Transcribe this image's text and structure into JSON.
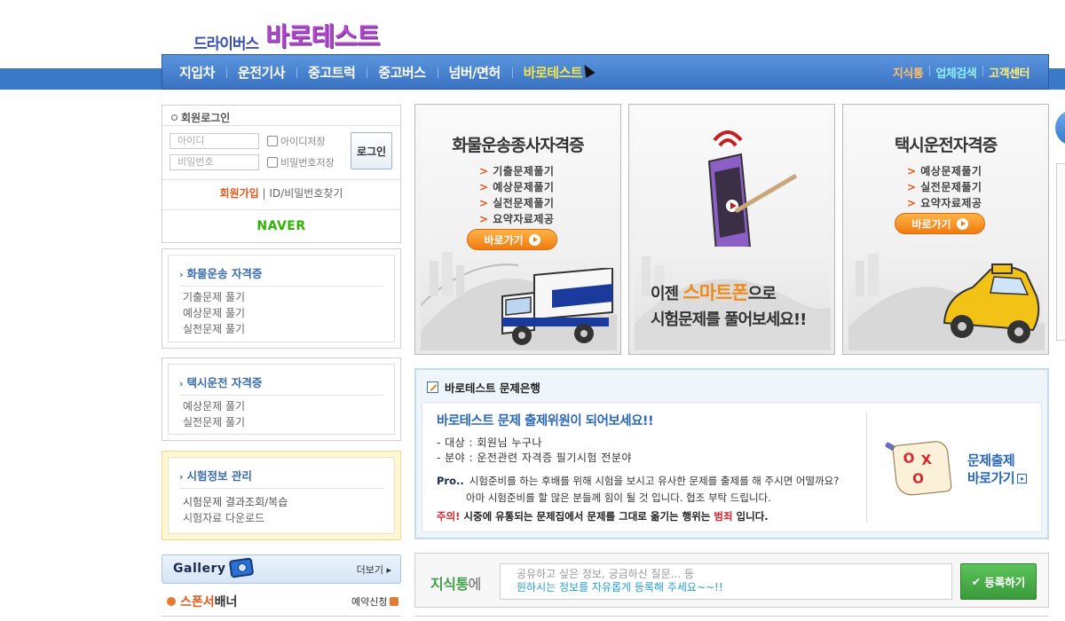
{
  "logo": {
    "small": "드라이버스",
    "big": "바로테스트"
  },
  "nav": {
    "items": [
      "지입차",
      "운전기사",
      "중고트럭",
      "중고버스",
      "넘버/면허",
      "바로테스트"
    ],
    "right": [
      "지식통",
      "업체검색",
      "고객센터"
    ]
  },
  "login": {
    "title": "회원로그인",
    "id_placeholder": "아이디",
    "pw_placeholder": "비밀번호",
    "save_id": "아이디저장",
    "save_pw": "비밀번호저장",
    "login_button": "로그인",
    "join": "회원가입",
    "divider": "|",
    "find": "ID/비밀번호찾기",
    "naver": "NAVER"
  },
  "cargo_menu": {
    "title": "화물운송 자격증",
    "items": [
      "기출문제 풀기",
      "예상문제 풀기",
      "실전문제 풀기"
    ]
  },
  "taxi_menu": {
    "title": "택시운전 자격증",
    "items": [
      "예상문제 풀기",
      "실전문제 풀기"
    ]
  },
  "exam_menu": {
    "title": "시험정보 관리",
    "items": [
      "시험문제 결과조회/복습",
      "시험자료 다운로드"
    ]
  },
  "gallery": {
    "title": "Gallery",
    "more": "더보기 ▸"
  },
  "sponsor": {
    "highlight": "스폰서",
    "rest": "배너",
    "reserve": "예약신청"
  },
  "banners": [
    {
      "title": "화물운송종사자격증",
      "items": [
        "기출문제풀기",
        "예상문제풀기",
        "실전문제풀기",
        "요약자료제공"
      ],
      "button": "바로가기"
    },
    {
      "line1_a": "이젠 ",
      "line1_b": "스마트폰",
      "line1_c": "으로",
      "line2": "시험문제를 풀어보세요!!"
    },
    {
      "title": "택시운전자격증",
      "items": [
        "예상문제풀기",
        "실전문제풀기",
        "요약자료제공"
      ],
      "button": "바로가기"
    }
  ],
  "qbank": {
    "header": "바로테스트 문제은행",
    "title": "바로테스트 문제 출제위원이 되어보세요!!",
    "target": "- 대상 : 회원님 누구나",
    "field": "- 분야 : 운전관련 자격증 필기시험 전분야",
    "pro_label": "Pro..",
    "pro_line1": "시험준비를 하는 후배를 위해 시험을 보시고 유사한 문제를 출제를 해 주시면 어떨까요?",
    "pro_line2": "아마 시험준비를 할 많은 분들께 힘이 될 것 입니다. 협조 부탁 드립니다.",
    "warn_label": "주의!",
    "warn_text_a": " 시중에 유통되는 문제집에서 문제를 그대로 옮기는 행위는 ",
    "warn_crime": "범죄",
    "warn_text_b": " 입니다.",
    "link_line1": "문제출제",
    "link_line2": "바로가기"
  },
  "jisik": {
    "label_a": "지식통",
    "label_b": "에",
    "placeholder1": "공유하고 싶은 정보, 궁금하신 질문... 등",
    "placeholder2": "원하시는 정보를 자유롭게 등록해 주세요~~!!",
    "register": "등록하기"
  }
}
